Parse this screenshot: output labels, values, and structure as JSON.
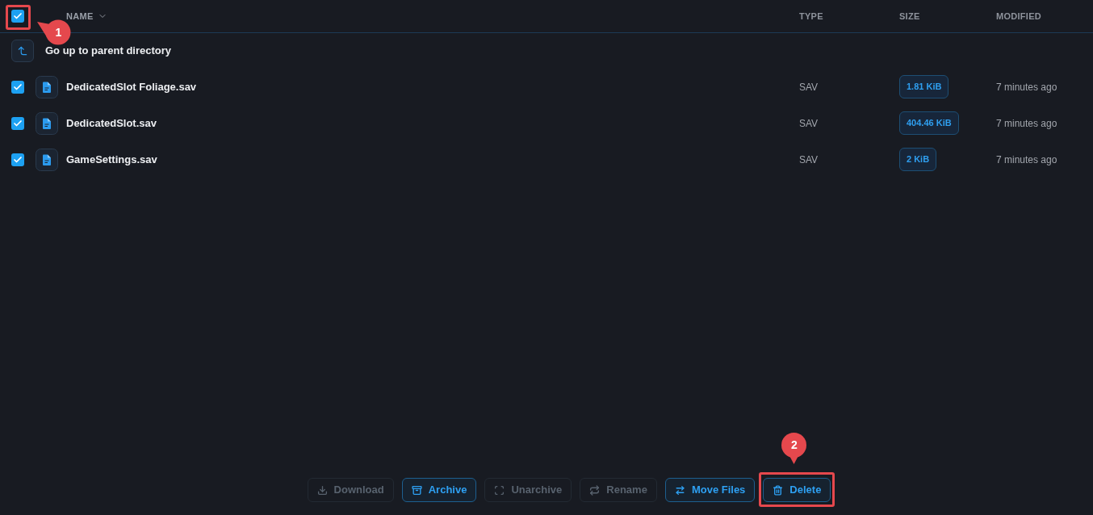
{
  "table": {
    "select_all": {
      "checked": true,
      "callout": "1"
    },
    "columns": [
      {
        "label": "NAME",
        "sorted": true
      },
      {
        "label": "TYPE",
        "sorted": false
      },
      {
        "label": "SIZE",
        "sorted": false
      },
      {
        "label": "MODIFIED",
        "sorted": false
      }
    ],
    "parent_row": {
      "label": "Go up to parent directory"
    },
    "rows": [
      {
        "name": "DedicatedSlot Foliage.sav",
        "selected": true,
        "type": "SAV",
        "size": "1.81 KiB",
        "modified": "7 minutes ago"
      },
      {
        "name": "DedicatedSlot.sav",
        "selected": true,
        "type": "SAV",
        "size": "404.46 KiB",
        "modified": "7 minutes ago"
      },
      {
        "name": "GameSettings.sav",
        "selected": true,
        "type": "SAV",
        "size": "2 KiB",
        "modified": "7 minutes ago"
      }
    ]
  },
  "actions": [
    {
      "kind": "download",
      "label": "Download",
      "disabled": true
    },
    {
      "kind": "archive",
      "label": "Archive",
      "disabled": false
    },
    {
      "kind": "unarchive",
      "label": "Unarchive",
      "disabled": true
    },
    {
      "kind": "rename",
      "label": "Rename",
      "disabled": true
    },
    {
      "kind": "move",
      "label": "Move Files",
      "disabled": false
    },
    {
      "kind": "delete",
      "label": "Delete",
      "disabled": false,
      "callout": "2"
    }
  ]
}
